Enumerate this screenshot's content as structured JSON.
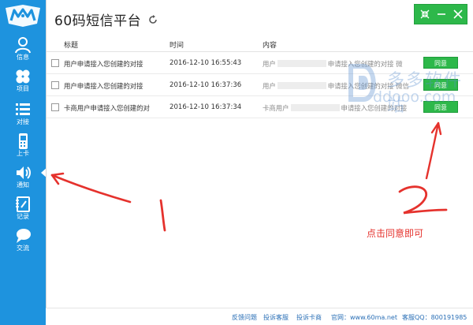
{
  "app": {
    "title": "60码短信平台"
  },
  "sidebar": {
    "items": [
      {
        "label": "信息",
        "icon": "person-icon"
      },
      {
        "label": "项目",
        "icon": "clover-icon"
      },
      {
        "label": "对接",
        "icon": "list-icon"
      },
      {
        "label": "上卡",
        "icon": "phone-icon"
      },
      {
        "label": "通知",
        "icon": "speaker-icon"
      },
      {
        "label": "记录",
        "icon": "notebook-icon"
      },
      {
        "label": "交流",
        "icon": "chat-bubble-icon"
      }
    ]
  },
  "table": {
    "headers": {
      "title": "标题",
      "time": "时间",
      "content": "内容"
    },
    "rows": [
      {
        "title": "用户申请接入您创建的对接",
        "time": "2016-12-10 16:55:43",
        "content_pre": "用户",
        "content_post": "申请接入您创建的对接 微",
        "action": "同意"
      },
      {
        "title": "用户申请接入您创建的对接",
        "time": "2016-12-10 16:37:36",
        "content_pre": "用户",
        "content_post": "申请接入您创建的对接 微信",
        "action": "同意"
      },
      {
        "title": "卡商用户申请接入您创建的对",
        "time": "2016-12-10 16:37:34",
        "content_pre": "卡商用户",
        "content_post": "申请接入您创建的对接",
        "action": "同意"
      }
    ]
  },
  "watermark": {
    "name": "多多软件站",
    "url": "ddooo.com"
  },
  "annotations": {
    "label_1": "1",
    "label_2": "2",
    "hint": "点击同意即可",
    "color": "#e5322d"
  },
  "footer": {
    "feedback": "反馈问题",
    "complain_service": "投诉客服",
    "complain_card": "投诉卡商",
    "site": "官网：www.60ma.net",
    "qq": "客服QQ：800191985"
  },
  "colors": {
    "sidebar": "#1e93de",
    "accent_green": "#2db84a",
    "link": "#2a6fb6"
  }
}
